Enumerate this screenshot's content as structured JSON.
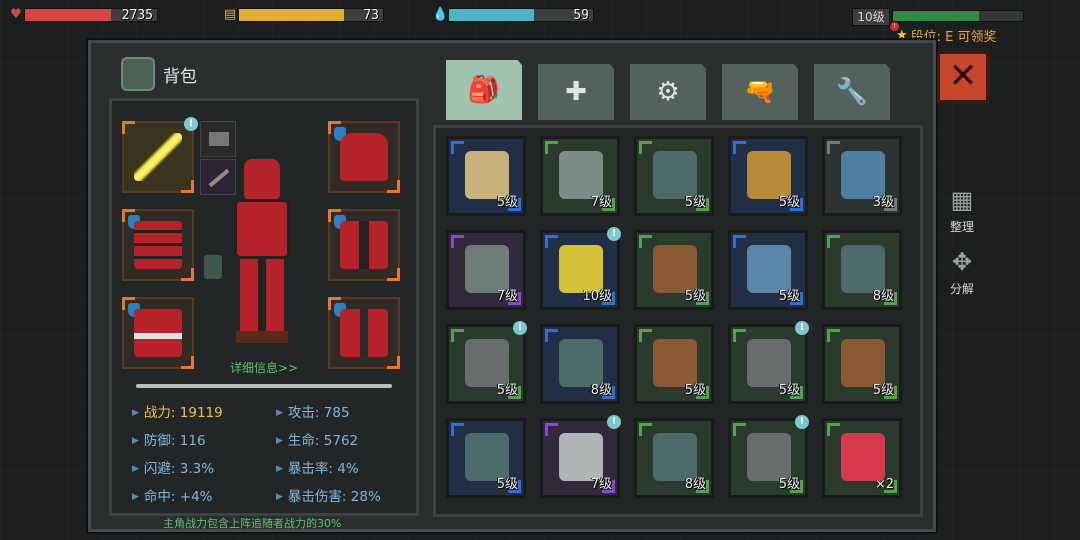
{
  "hud": {
    "hp": {
      "value": "2735",
      "fraction": 0.65,
      "color": "#d94545",
      "icon": "heart-icon"
    },
    "food": {
      "value": "73",
      "fraction": 0.73,
      "color": "#e0b030",
      "icon": "food-icon"
    },
    "water": {
      "value": "59",
      "fraction": 0.59,
      "color": "#4fb3c8",
      "icon": "water-drop-icon"
    },
    "level": {
      "label": "10级",
      "fraction": 0.66
    },
    "rank": {
      "text": "段位: E 可领奖",
      "badge": "!"
    }
  },
  "panel": {
    "title": "背包",
    "detail_link": "详细信息>>",
    "footnote": "主角战力包含上阵追随者战力的30%",
    "close": "✕"
  },
  "tabs": [
    {
      "name": "backpack",
      "glyph": "🎒"
    },
    {
      "name": "medical",
      "glyph": "✚"
    },
    {
      "name": "materials",
      "glyph": "⚙"
    },
    {
      "name": "weapons",
      "glyph": "🔫"
    },
    {
      "name": "tools",
      "glyph": "🔧"
    }
  ],
  "stats": {
    "power": "战力: 19119",
    "attack": "攻击: 785",
    "defense": "防御: 116",
    "hp": "生命: 5762",
    "dodge": "闪避: 3.3%",
    "crit_rate": "暴击率: 4%",
    "hit": "命中: +4%",
    "crit_dmg": "暴击伤害: 28%"
  },
  "equipment": [
    {
      "slot": "weapon",
      "name": "lightsaber",
      "badge": "!"
    },
    {
      "slot": "helmet",
      "name": "red-samurai-helmet"
    },
    {
      "slot": "chest",
      "name": "red-samurai-armor"
    },
    {
      "slot": "gloves",
      "name": "red-samurai-gauntlet"
    },
    {
      "slot": "boots",
      "name": "red-samurai-boots"
    },
    {
      "slot": "legs",
      "name": "red-samurai-greaves"
    }
  ],
  "inventory": [
    {
      "name": "jacket",
      "level": "5级",
      "rarity": "blue",
      "color": "#c9b27a",
      "badge": ""
    },
    {
      "name": "vest",
      "level": "7级",
      "rarity": "green",
      "color": "#7c8c86",
      "badge": ""
    },
    {
      "name": "beanie",
      "level": "5级",
      "rarity": "green",
      "color": "#4c6b6a",
      "badge": ""
    },
    {
      "name": "boots",
      "level": "5级",
      "rarity": "blue",
      "color": "#b88a3a",
      "badge": ""
    },
    {
      "name": "jeans",
      "level": "3级",
      "rarity": "grey",
      "color": "#4f7fa0",
      "badge": ""
    },
    {
      "name": "vest",
      "level": "7级",
      "rarity": "purple",
      "color": "#6f7d78",
      "badge": ""
    },
    {
      "name": "blaster",
      "level": "10级",
      "rarity": "blue",
      "color": "#d6c23a",
      "badge": "!"
    },
    {
      "name": "rifle",
      "level": "5级",
      "rarity": "green",
      "color": "#8a5a32",
      "badge": ""
    },
    {
      "name": "jeans",
      "level": "5级",
      "rarity": "blue",
      "color": "#5b86a8",
      "badge": ""
    },
    {
      "name": "beanie",
      "level": "8级",
      "rarity": "green",
      "color": "#4c6b6a",
      "badge": ""
    },
    {
      "name": "pistol",
      "level": "5级",
      "rarity": "green",
      "color": "#6a6d6e",
      "badge": "!"
    },
    {
      "name": "beanie",
      "level": "8级",
      "rarity": "blue",
      "color": "#4c6b6a",
      "badge": ""
    },
    {
      "name": "rifle",
      "level": "5级",
      "rarity": "green",
      "color": "#8a5a32",
      "badge": ""
    },
    {
      "name": "pistol",
      "level": "5级",
      "rarity": "green",
      "color": "#6a6d6e",
      "badge": "!"
    },
    {
      "name": "rifle",
      "level": "5级",
      "rarity": "green",
      "color": "#8a5a32",
      "badge": ""
    },
    {
      "name": "beanie",
      "level": "5级",
      "rarity": "blue",
      "color": "#4c6b6a",
      "badge": ""
    },
    {
      "name": "machete",
      "level": "7级",
      "rarity": "purple",
      "color": "#b0b6b5",
      "badge": "!"
    },
    {
      "name": "beanie",
      "level": "8级",
      "rarity": "green",
      "color": "#4c6b6a",
      "badge": ""
    },
    {
      "name": "pistol",
      "level": "5级",
      "rarity": "green",
      "color": "#6a6d6e",
      "badge": "!"
    },
    {
      "name": "juice",
      "level": "×2",
      "rarity": "green",
      "color": "#d43a4a",
      "badge": ""
    }
  ],
  "side": {
    "sort": "整理",
    "disassemble": "分解"
  }
}
